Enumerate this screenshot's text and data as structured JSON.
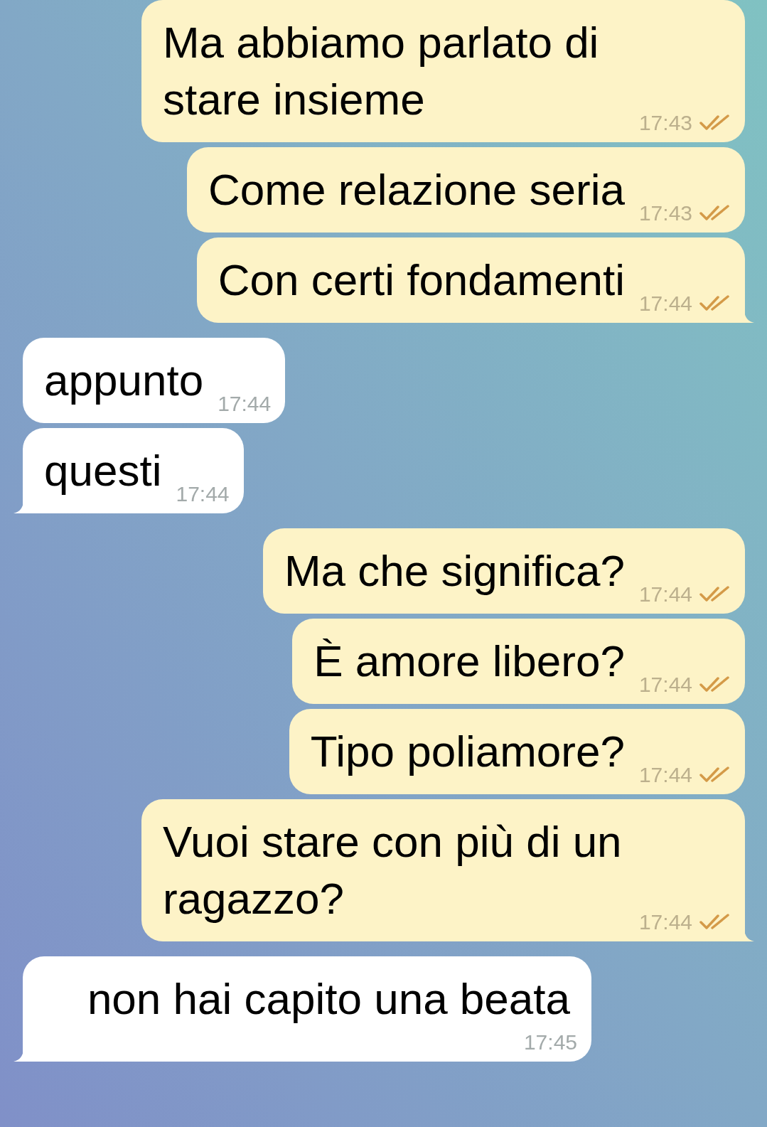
{
  "messages": [
    {
      "kind": "outgoing",
      "text": "Ma abbiamo parlato di stare insieme",
      "time": "17:43",
      "read": true,
      "tail": false
    },
    {
      "kind": "outgoing",
      "text": "Come relazione seria",
      "time": "17:43",
      "read": true,
      "tail": false
    },
    {
      "kind": "outgoing",
      "text": "Con certi fondamenti",
      "time": "17:44",
      "read": true,
      "tail": true
    },
    {
      "kind": "incoming",
      "text": "appunto",
      "time": "17:44",
      "tail": false
    },
    {
      "kind": "incoming",
      "text": "questi",
      "time": "17:44",
      "tail": true
    },
    {
      "kind": "outgoing",
      "text": "Ma che significa?",
      "time": "17:44",
      "read": true,
      "tail": false
    },
    {
      "kind": "outgoing",
      "text": "È amore libero?",
      "time": "17:44",
      "read": true,
      "tail": false
    },
    {
      "kind": "outgoing",
      "text": "Tipo poliamore?",
      "time": "17:44",
      "read": true,
      "tail": false
    },
    {
      "kind": "outgoing",
      "text": "Vuoi stare con più di un ragazzo?",
      "time": "17:44",
      "read": true,
      "tail": true
    },
    {
      "kind": "incoming",
      "text": "non hai capito una beata",
      "time": "17:45",
      "tail": true
    }
  ]
}
